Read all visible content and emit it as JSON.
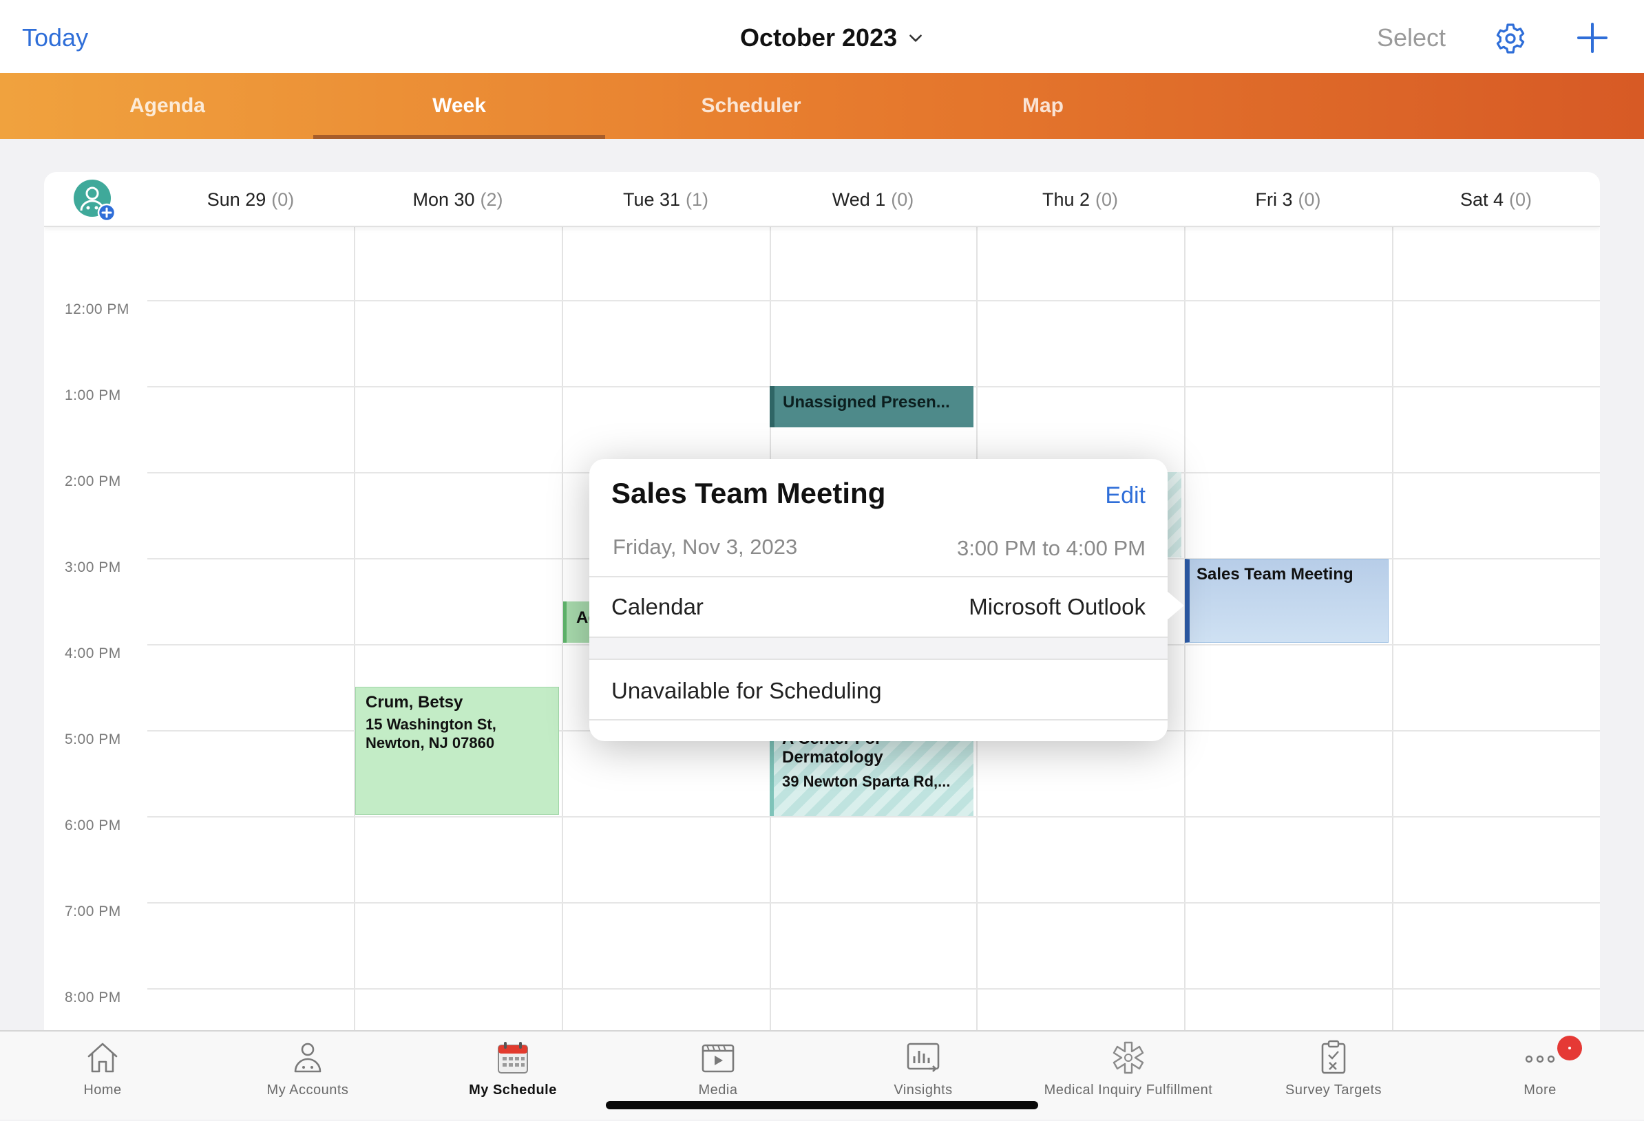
{
  "topbar": {
    "today_label": "Today",
    "month_label": "October 2023",
    "select_label": "Select",
    "accent_color": "#2f6ed8"
  },
  "tabs": [
    {
      "label": "Agenda",
      "active": false
    },
    {
      "label": "Week",
      "active": true
    },
    {
      "label": "Scheduler",
      "active": false
    },
    {
      "label": "Map",
      "active": false
    }
  ],
  "week": {
    "days": [
      {
        "label": "Sun 29",
        "count": "(0)"
      },
      {
        "label": "Mon 30",
        "count": "(2)"
      },
      {
        "label": "Tue 31",
        "count": "(1)"
      },
      {
        "label": "Wed 1",
        "count": "(0)"
      },
      {
        "label": "Thu 2",
        "count": "(0)"
      },
      {
        "label": "Fri 3",
        "count": "(0)"
      },
      {
        "label": "Sat 4",
        "count": "(0)"
      }
    ],
    "hours": [
      "12:00 PM",
      "1:00 PM",
      "2:00 PM",
      "3:00 PM",
      "4:00 PM",
      "5:00 PM",
      "6:00 PM",
      "7:00 PM",
      "8:00 PM"
    ]
  },
  "events": {
    "unassigned": {
      "title": "Unassigned Presen..."
    },
    "crum": {
      "title": "Crum, Betsy",
      "line1": "15 Washington St,",
      "line2": "Newton, NJ 07860"
    },
    "ac_partial": {
      "title": "Ac"
    },
    "dermatology": {
      "title_line1": "A Center For",
      "title_line2": "Dermatology",
      "address": "39 Newton Sparta Rd,..."
    },
    "sales": {
      "title": "Sales Team Meeting"
    }
  },
  "popover": {
    "title": "Sales Team Meeting",
    "edit_label": "Edit",
    "date": "Friday, Nov 3, 2023",
    "time": "3:00 PM to 4:00 PM",
    "calendar_label": "Calendar",
    "calendar_value": "Microsoft Outlook",
    "status": "Unavailable for Scheduling"
  },
  "bottom_nav": [
    {
      "label": "Home",
      "icon": "home-icon"
    },
    {
      "label": "My Accounts",
      "icon": "accounts-icon"
    },
    {
      "label": "My Schedule",
      "icon": "calendar-icon",
      "active": true
    },
    {
      "label": "Media",
      "icon": "media-icon"
    },
    {
      "label": "Vinsights",
      "icon": "insights-icon"
    },
    {
      "label": "Medical Inquiry Fulfillment",
      "icon": "medical-icon"
    },
    {
      "label": "Survey Targets",
      "icon": "survey-icon"
    },
    {
      "label": "More",
      "icon": "more-icon"
    }
  ]
}
